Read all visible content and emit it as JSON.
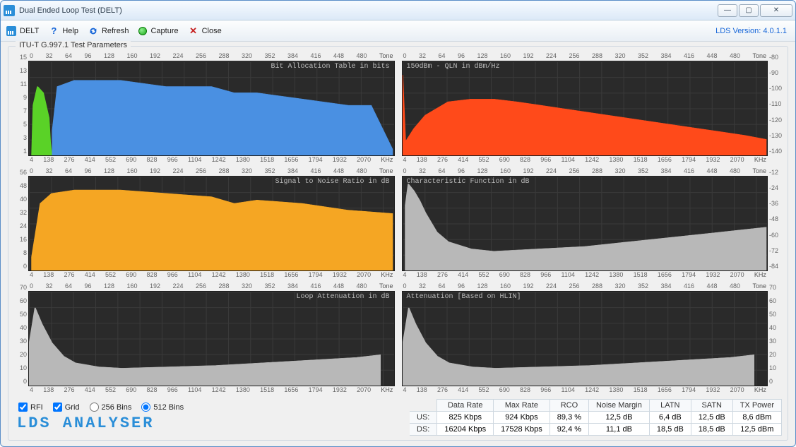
{
  "window": {
    "title": "Dual Ended Loop Test (DELT)"
  },
  "toolbar": {
    "delt": "DELT",
    "help": "Help",
    "refresh": "Refresh",
    "capture": "Capture",
    "close": "Close",
    "version_label": "LDS Version: 4.0.1.1"
  },
  "group_title": "ITU-T G.997.1 Test Parameters",
  "axes": {
    "top_tone": [
      "0",
      "32",
      "64",
      "96",
      "128",
      "160",
      "192",
      "224",
      "256",
      "288",
      "320",
      "352",
      "384",
      "416",
      "448",
      "480",
      "Tone"
    ],
    "bottom_khz": [
      "4",
      "138",
      "276",
      "414",
      "552",
      "690",
      "828",
      "966",
      "1104",
      "1242",
      "1380",
      "1518",
      "1656",
      "1794",
      "1932",
      "2070",
      "KHz"
    ],
    "bit_y": [
      "15",
      "13",
      "11",
      "9",
      "7",
      "5",
      "3",
      "1"
    ],
    "qln_y": [
      "-80",
      "-90",
      "-100",
      "-110",
      "-120",
      "-130",
      "-140"
    ],
    "snr_y": [
      "56",
      "48",
      "40",
      "32",
      "24",
      "16",
      "8",
      "0"
    ],
    "char_y": [
      "-12",
      "-24",
      "-36",
      "-48",
      "-60",
      "-72",
      "-84"
    ],
    "att_y": [
      "70",
      "60",
      "50",
      "40",
      "30",
      "20",
      "10",
      "0"
    ]
  },
  "chart_titles": {
    "bit": "Bit Allocation Table in bits",
    "qln": "150dBm - QLN in dBm/Hz",
    "snr": "Signal to Noise Ratio in dB",
    "char": "Characteristic Function in dB",
    "latt": "Loop Attenuation in dB",
    "hlin": "Attenuation [Based on HLIN]"
  },
  "controls": {
    "rfi": "RFI",
    "grid": "Grid",
    "bins256": "256 Bins",
    "bins512": "512 Bins",
    "rfi_checked": true,
    "grid_checked": true,
    "bins_selected": "512"
  },
  "brand": "LDS ANALYSER",
  "stats": {
    "headers": [
      "Data Rate",
      "Max Rate",
      "RCO",
      "Noise Margin",
      "LATN",
      "SATN",
      "TX Power"
    ],
    "rows": [
      {
        "label": "US:",
        "cells": [
          "825 Kbps",
          "924 Kbps",
          "89,3 %",
          "12,5 dB",
          "6,4 dB",
          "12,5 dB",
          "8,6 dBm"
        ]
      },
      {
        "label": "DS:",
        "cells": [
          "16204 Kbps",
          "17528 Kbps",
          "92,4 %",
          "11,1 dB",
          "18,5 dB",
          "18,5 dB",
          "12,5 dBm"
        ]
      }
    ]
  },
  "chart_data": [
    {
      "type": "area",
      "title": "Bit Allocation Table in bits",
      "xlabel": "Tone",
      "ylabel": "bits",
      "x_range": [
        0,
        512
      ],
      "ylim": [
        0,
        15
      ],
      "series": [
        {
          "name": "US",
          "color": "#5ad227",
          "x": [
            4,
            6,
            12,
            20,
            28,
            30,
            32
          ],
          "values": [
            0,
            8,
            11,
            10,
            6,
            2,
            0
          ]
        },
        {
          "name": "DS",
          "color": "#4a90e2",
          "x": [
            33,
            40,
            64,
            128,
            192,
            256,
            288,
            320,
            384,
            448,
            480,
            510
          ],
          "values": [
            4,
            11,
            12,
            12,
            11,
            11,
            10,
            10,
            9,
            8,
            8,
            1
          ]
        }
      ]
    },
    {
      "type": "area",
      "title": "150dBm - QLN in dBm/Hz",
      "xlabel": "Tone",
      "ylabel": "dBm/Hz",
      "x_range": [
        0,
        512
      ],
      "ylim": [
        -150,
        -80
      ],
      "color": "#ff4a1a",
      "x": [
        0,
        4,
        16,
        32,
        64,
        96,
        128,
        160,
        224,
        288,
        352,
        416,
        480,
        510
      ],
      "values": [
        -90,
        -140,
        -130,
        -120,
        -110,
        -108,
        -108,
        -110,
        -115,
        -120,
        -125,
        -130,
        -135,
        -138
      ]
    },
    {
      "type": "area",
      "title": "Signal to Noise Ratio in dB",
      "xlabel": "Tone",
      "ylabel": "dB",
      "x_range": [
        0,
        512
      ],
      "ylim": [
        0,
        56
      ],
      "color": "#f5a623",
      "x": [
        4,
        16,
        32,
        64,
        128,
        192,
        256,
        288,
        320,
        384,
        448,
        510
      ],
      "values": [
        8,
        40,
        46,
        48,
        48,
        46,
        44,
        40,
        42,
        40,
        36,
        34
      ]
    },
    {
      "type": "area",
      "title": "Characteristic Function in dB",
      "xlabel": "Tone",
      "ylabel": "dB",
      "x_range": [
        0,
        512
      ],
      "ylim": [
        -90,
        -12
      ],
      "color": "#b8b8b8",
      "x": [
        4,
        8,
        16,
        24,
        32,
        48,
        64,
        96,
        128,
        192,
        256,
        320,
        384,
        448,
        510
      ],
      "values": [
        -36,
        -18,
        -24,
        -32,
        -42,
        -58,
        -66,
        -72,
        -74,
        -72,
        -70,
        -66,
        -62,
        -58,
        -54
      ]
    },
    {
      "type": "area",
      "title": "Loop Attenuation in dB",
      "xlabel": "KHz",
      "ylabel": "dB",
      "x_range": [
        4,
        2150
      ],
      "ylim": [
        0,
        70
      ],
      "color": "#b8b8b8",
      "x": [
        4,
        40,
        80,
        138,
        207,
        276,
        414,
        552,
        828,
        1104,
        1380,
        1656,
        1932,
        2070
      ],
      "values": [
        30,
        58,
        46,
        32,
        22,
        17,
        14,
        13,
        14,
        15,
        17,
        19,
        21,
        23
      ]
    },
    {
      "type": "area",
      "title": "Attenuation [Based on HLIN]",
      "xlabel": "KHz",
      "ylabel": "dB",
      "x_range": [
        4,
        2150
      ],
      "ylim": [
        0,
        70
      ],
      "color": "#b8b8b8",
      "x": [
        4,
        40,
        80,
        138,
        207,
        276,
        414,
        552,
        828,
        1104,
        1380,
        1656,
        1932,
        2070
      ],
      "values": [
        30,
        58,
        46,
        32,
        22,
        17,
        14,
        13,
        14,
        15,
        17,
        19,
        21,
        23
      ]
    }
  ]
}
